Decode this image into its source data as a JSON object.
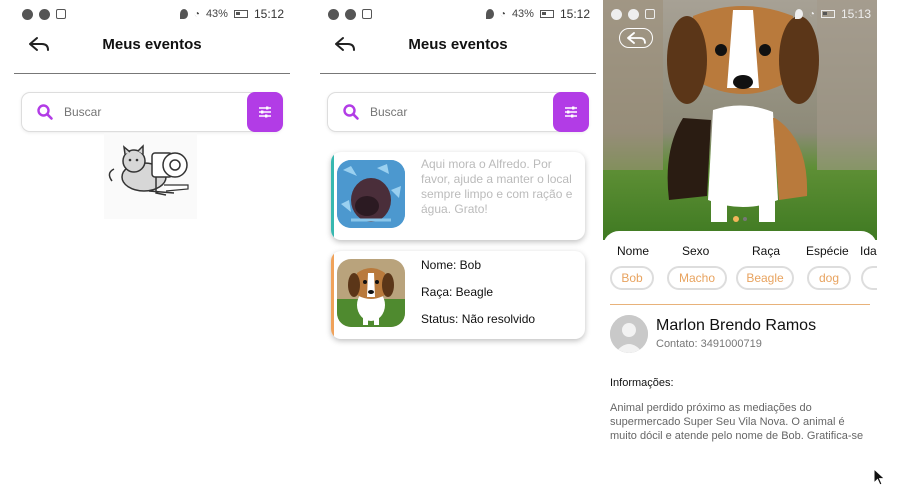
{
  "statusbar": {
    "battery": "43%",
    "time_1": "15:12",
    "time_2": "15:12",
    "time_3": "15:13"
  },
  "screen1": {
    "title": "Meus eventos",
    "search_placeholder": "Buscar"
  },
  "screen2": {
    "title": "Meus eventos",
    "search_placeholder": "Buscar",
    "cards": [
      {
        "description": "Aqui mora o Alfredo. Por favor, ajude a manter o local sempre limpo e com ração e água. Grato!",
        "accent": "#37b8b0"
      },
      {
        "name": "Nome: Bob",
        "breed": "Raça: Beagle",
        "status": "Status: Não resolvido",
        "accent": "#f0a25a"
      }
    ]
  },
  "screen3": {
    "attribute_labels": [
      "Nome",
      "Sexo",
      "Raça",
      "Espécie",
      "Ida"
    ],
    "attribute_values": [
      "Bob",
      "Macho",
      "Beagle",
      "dog",
      ""
    ],
    "owner_name": "Marlon Brendo Ramos",
    "owner_contact": "Contato: 3491000719",
    "info_title": "Informações:",
    "info_text": "Animal perdido próximo as mediações do supermercado Super Seu Vila Nova. O animal é muito dócil e atende pelo nome de Bob. Gratifica-se"
  },
  "colors": {
    "accent_purple": "#b23ce6",
    "chip_text": "#e8a35f"
  }
}
